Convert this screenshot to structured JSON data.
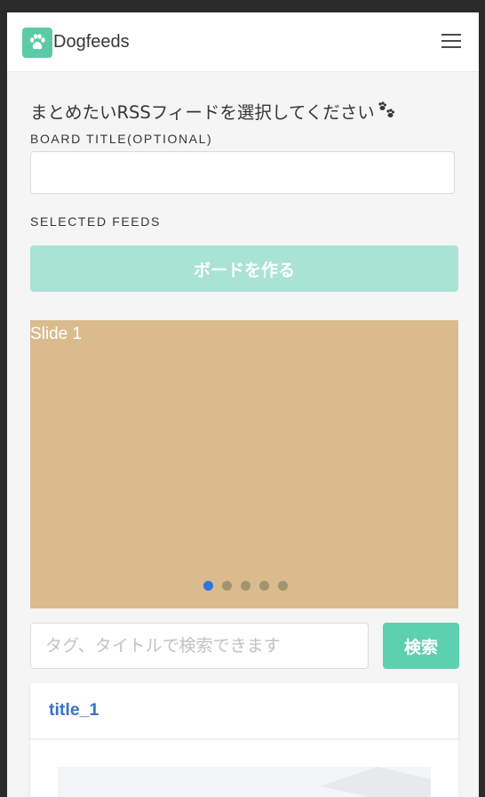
{
  "app": {
    "brand": "Dogfeeds"
  },
  "navbar": {
    "menu_icon": "hamburger-menu-icon",
    "logo_icon": "paw-icon"
  },
  "form": {
    "heading": "まとめたいRSSフィードを選択してください",
    "heading_icon": "paw-prints-icon",
    "board_title_label": "BOARD TITLE(OPTIONAL)",
    "board_title_value": "",
    "selected_feeds_label": "SELECTED FEEDS",
    "create_button": "ボードを作る"
  },
  "carousel": {
    "slide_label": "Slide 1",
    "slide_count": 5,
    "active_index": 0
  },
  "search": {
    "placeholder": "タグ、タイトルで検索できます",
    "button": "検索"
  },
  "cards": [
    {
      "title": "title_1"
    }
  ],
  "colors": {
    "accent": "#5dd0b0",
    "accent_disabled": "#a8e3d3",
    "slide_bg": "#d9bb8d",
    "link": "#3b71c6",
    "active_dot": "#3273dc"
  }
}
